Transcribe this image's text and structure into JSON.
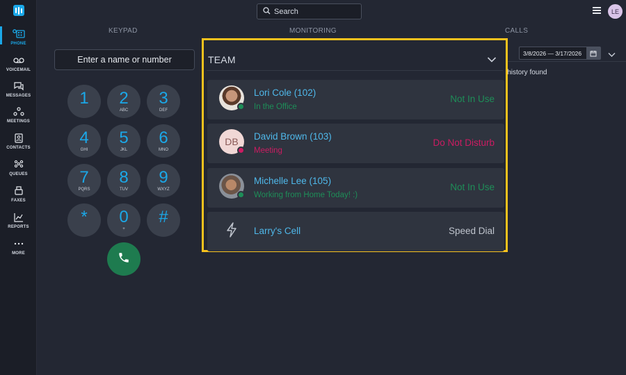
{
  "sidebar": {
    "items": [
      {
        "label": "PHONE",
        "icon": "phone-icon"
      },
      {
        "label": "VOICEMAIL",
        "icon": "voicemail-icon"
      },
      {
        "label": "MESSAGES",
        "icon": "messages-icon"
      },
      {
        "label": "MEETINGS",
        "icon": "meetings-icon"
      },
      {
        "label": "CONTACTS",
        "icon": "contacts-icon"
      },
      {
        "label": "QUEUES",
        "icon": "queues-icon"
      },
      {
        "label": "FAXES",
        "icon": "faxes-icon"
      },
      {
        "label": "REPORTS",
        "icon": "reports-icon"
      },
      {
        "label": "MORE",
        "icon": "more-icon"
      }
    ]
  },
  "header": {
    "search_placeholder": "Search",
    "user_initials": "LE"
  },
  "columns": {
    "keypad": "KEYPAD",
    "monitoring": "MONITORING",
    "calls": "CALLS"
  },
  "keypad": {
    "input_placeholder": "Enter a name or number",
    "keys": [
      {
        "digit": "1",
        "letters": ""
      },
      {
        "digit": "2",
        "letters": "ABC"
      },
      {
        "digit": "3",
        "letters": "DEF"
      },
      {
        "digit": "4",
        "letters": "GHI"
      },
      {
        "digit": "5",
        "letters": "JKL"
      },
      {
        "digit": "6",
        "letters": "MNO"
      },
      {
        "digit": "7",
        "letters": "PQRS"
      },
      {
        "digit": "8",
        "letters": "TUV"
      },
      {
        "digit": "9",
        "letters": "WXYZ"
      },
      {
        "digit": "*",
        "letters": ""
      },
      {
        "digit": "0",
        "letters": "+"
      },
      {
        "digit": "#",
        "letters": ""
      }
    ]
  },
  "calls": {
    "date_range": "3/8/2026 — 3/17/2026",
    "empty_text": "ll history found"
  },
  "team": {
    "title": "TEAM",
    "members": [
      {
        "name": "Lori Cole (102)",
        "note": "In the Office",
        "status": "Not In Use",
        "presence": "available"
      },
      {
        "name": "David Brown (103)",
        "note": "Meeting",
        "status": "Do Not Disturb",
        "presence": "dnd",
        "initials": "DB"
      },
      {
        "name": "Michelle Lee (105)",
        "note": "Working from Home Today! :)",
        "status": "Not In Use",
        "presence": "available"
      },
      {
        "name": "Larry's Cell",
        "note": "",
        "status": "Speed Dial",
        "presence": "speed-dial"
      }
    ]
  },
  "colors": {
    "accent": "#1ba8e8",
    "highlight_border": "#f7c21d",
    "available": "#1e8e58",
    "dnd": "#cc1c62",
    "call_button": "#1e7b4f"
  }
}
